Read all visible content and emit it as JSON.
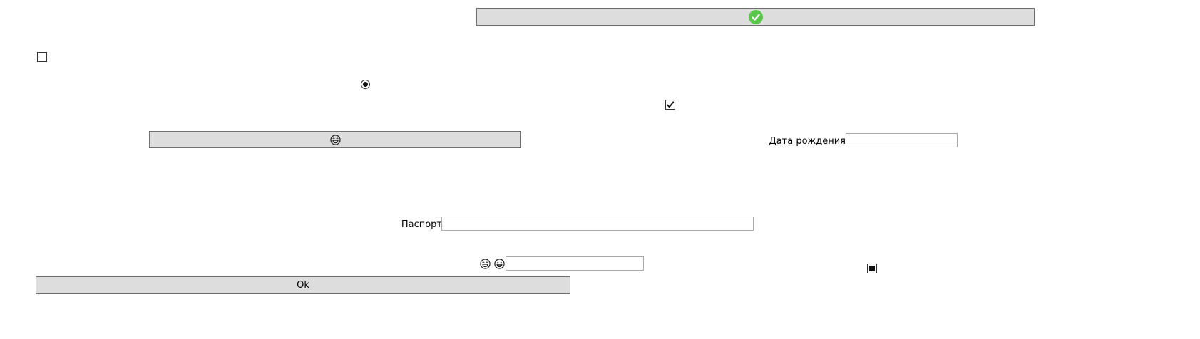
{
  "controls": {
    "top_button": {
      "icon": "check-circle-icon",
      "icon_color": "#59c74a"
    },
    "checkbox_unchecked": {
      "checked": false
    },
    "radio_selected": {
      "selected": true
    },
    "checkbox_checked": {
      "checked": true
    },
    "emoji_button": {
      "icon": "laughing-face-icon"
    },
    "birth_date": {
      "label": "Дата рождения",
      "value": ""
    },
    "passport": {
      "label": "Паспорт",
      "value": ""
    },
    "emoji_field": {
      "icons": [
        "laughing-face-icon",
        "grinning-face-icon"
      ],
      "value": ""
    },
    "checkbox_indeterminate": {
      "state": "indeterminate"
    },
    "ok_button": {
      "label": "Ok"
    }
  },
  "colors": {
    "button_bg": "#dddddd",
    "button_border": "#707070",
    "textbox_border": "#a9a9a9",
    "accent_check": "#59c74a"
  }
}
